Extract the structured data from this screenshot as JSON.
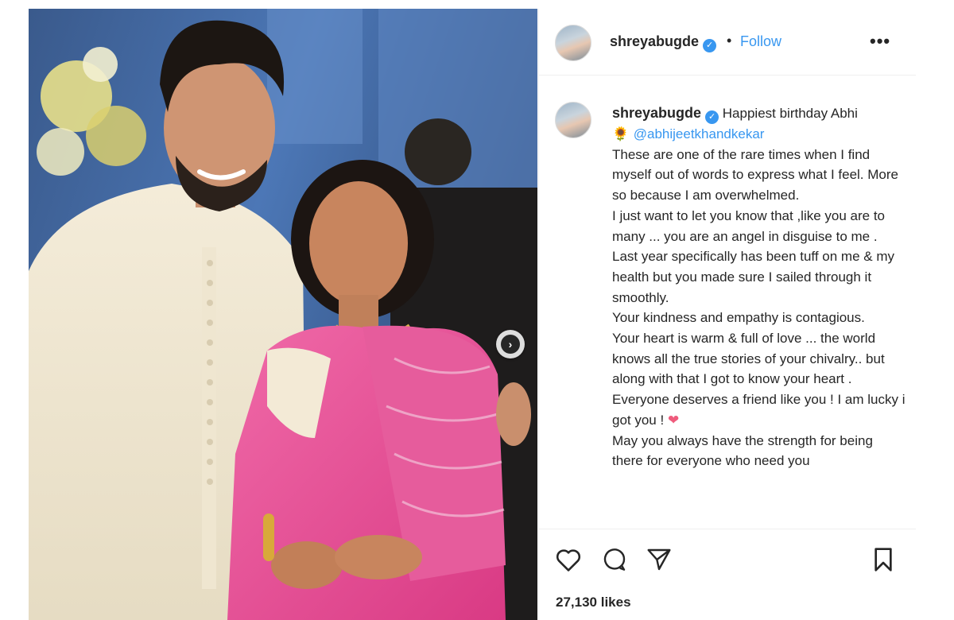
{
  "post": {
    "username": "shreyabugde",
    "verified_glyph": "✓",
    "separator": "•",
    "follow_label": "Follow",
    "more_label": "•••",
    "next_glyph": "›",
    "caption": {
      "username": "shreyabugde",
      "first_line": "Happiest birthday Abhi",
      "emoji_sunflower": "🌻",
      "mention": "@abhijeetkhandkekar",
      "body": "These are one of the rare times when I find myself out of words to express what I feel. More so because I am overwhelmed.\nI just want to let you know that ,like you are to many ... you are an angel in disguise to me .\nLast year specifically has been tuff on me & my health but you made sure I sailed through it smoothly.\nYour kindness and empathy is contagious.\nYour heart is warm & full of love ... the world knows all the true stories of your chivalry.. but along with that I got to know your heart . Everyone deserves a friend like you ! I am lucky i got you !",
      "emoji_heart": "❤",
      "body_end": "May you always have the strength for being there for everyone who need you"
    },
    "likes": "27,130 likes"
  },
  "icons": {
    "like": "heart-icon",
    "comment": "comment-icon",
    "share": "send-icon",
    "save": "bookmark-icon",
    "next": "chevron-right-icon"
  },
  "colors": {
    "accent": "#3897f0",
    "text": "#262626",
    "saree_pink": "#e0458e"
  }
}
